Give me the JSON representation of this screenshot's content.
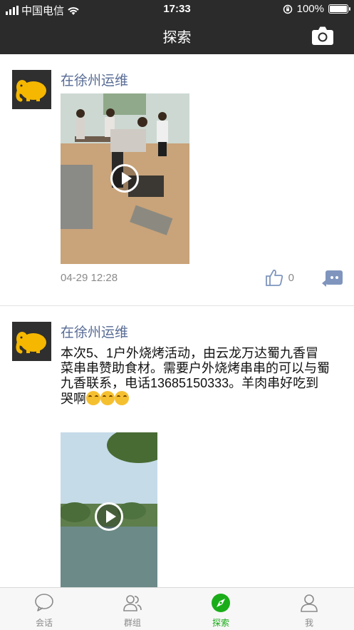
{
  "status_bar": {
    "carrier": "中国电信",
    "time": "17:33",
    "battery": "100%"
  },
  "nav": {
    "title": "探索"
  },
  "posts": [
    {
      "username": "在徐州运维",
      "time": "04-29 12:28",
      "likes": "0"
    },
    {
      "username": "在徐州运维",
      "text": "本次5、1户外烧烤活动，由云龙万达蜀九香冒菜串串赞助食材。需要户外烧烤串串的可以与蜀九香联系，电话13685150333。羊肉串好吃到哭啊"
    }
  ],
  "tabs": [
    {
      "label": "会话",
      "icon": "chat-bubble-icon"
    },
    {
      "label": "群组",
      "icon": "group-icon"
    },
    {
      "label": "探索",
      "icon": "compass-icon"
    },
    {
      "label": "我",
      "icon": "person-icon"
    }
  ],
  "colors": {
    "nav_bg": "#2b2b2b",
    "link": "#576b95",
    "active_tab": "#1aad19"
  }
}
